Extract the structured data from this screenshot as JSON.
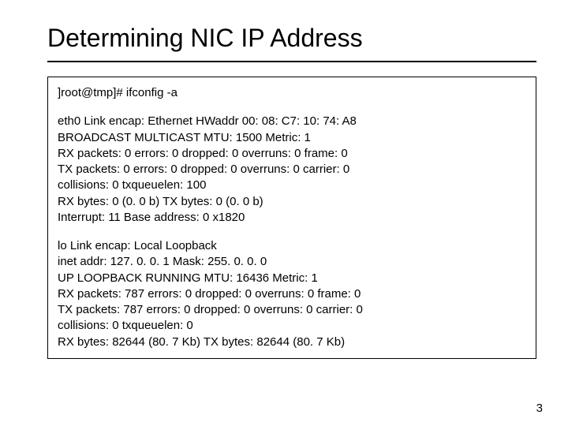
{
  "title": "Determining NIC IP Address",
  "command": "]root@tmp]# ifconfig -a",
  "eth0": {
    "l1": "eth0 Link encap: Ethernet HWaddr 00: 08: C7: 10: 74: A8",
    "l2": "BROADCAST MULTICAST MTU: 1500 Metric: 1",
    "l3": "RX packets: 0 errors: 0 dropped: 0 overruns: 0 frame: 0",
    "l4": "TX packets: 0 errors: 0 dropped: 0 overruns: 0 carrier: 0",
    "l5": "collisions: 0 txqueuelen: 100",
    "l6": "RX bytes: 0 (0. 0 b) TX bytes: 0 (0. 0 b)",
    "l7": "Interrupt: 11 Base address: 0 x1820"
  },
  "lo": {
    "l1": "lo Link encap: Local Loopback",
    "l2": "inet addr: 127. 0. 0. 1 Mask: 255. 0. 0. 0",
    "l3": "UP LOOPBACK RUNNING MTU: 16436 Metric: 1",
    "l4": "RX packets: 787 errors: 0 dropped: 0 overruns: 0 frame: 0",
    "l5": "TX packets: 787 errors: 0 dropped: 0 overruns: 0 carrier: 0",
    "l6": "collisions: 0 txqueuelen: 0",
    "l7": "RX bytes: 82644 (80. 7 Kb) TX bytes: 82644 (80. 7 Kb)"
  },
  "page_number": "3"
}
